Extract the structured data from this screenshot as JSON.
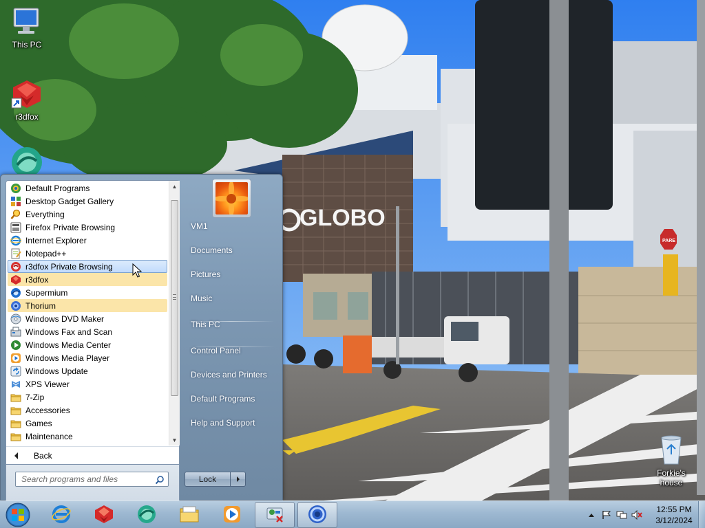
{
  "desktop": {
    "icons": [
      {
        "label": "This PC",
        "icon": "computer-icon"
      },
      {
        "label": "r3dfox",
        "icon": "r3dfox-icon"
      },
      {
        "label": "",
        "icon": "supermium-icon"
      },
      {
        "label": "Forkie's house",
        "icon": "recycle-bin-icon"
      }
    ],
    "wallpaper_sign": "GLOBO",
    "wallpaper_stop_sign": "PARE"
  },
  "start_menu": {
    "programs": [
      {
        "label": "Default Programs",
        "icon": "default-programs-icon",
        "state": ""
      },
      {
        "label": "Desktop Gadget Gallery",
        "icon": "gadget-gallery-icon",
        "state": ""
      },
      {
        "label": "Everything",
        "icon": "everything-search-icon",
        "state": ""
      },
      {
        "label": "Firefox Private Browsing",
        "icon": "firefox-private-icon",
        "state": ""
      },
      {
        "label": "Internet Explorer",
        "icon": "internet-explorer-icon",
        "state": ""
      },
      {
        "label": "Notepad++",
        "icon": "notepad-plus-plus-icon",
        "state": ""
      },
      {
        "label": "r3dfox Private Browsing",
        "icon": "r3dfox-private-icon",
        "state": "hover"
      },
      {
        "label": "r3dfox",
        "icon": "r3dfox-icon",
        "state": "recent"
      },
      {
        "label": "Supermium",
        "icon": "supermium-icon",
        "state": ""
      },
      {
        "label": "Thorium",
        "icon": "thorium-icon",
        "state": "recent"
      },
      {
        "label": "Windows DVD Maker",
        "icon": "dvd-maker-icon",
        "state": ""
      },
      {
        "label": "Windows Fax and Scan",
        "icon": "fax-scan-icon",
        "state": ""
      },
      {
        "label": "Windows Media Center",
        "icon": "media-center-icon",
        "state": ""
      },
      {
        "label": "Windows Media Player",
        "icon": "media-player-icon",
        "state": ""
      },
      {
        "label": "Windows Update",
        "icon": "windows-update-icon",
        "state": ""
      },
      {
        "label": "XPS Viewer",
        "icon": "xps-viewer-icon",
        "state": ""
      },
      {
        "label": "7-Zip",
        "icon": "folder-icon",
        "state": ""
      },
      {
        "label": "Accessories",
        "icon": "folder-icon",
        "state": ""
      },
      {
        "label": "Games",
        "icon": "folder-icon",
        "state": ""
      },
      {
        "label": "Maintenance",
        "icon": "folder-icon",
        "state": ""
      }
    ],
    "back_label": "Back",
    "search_placeholder": "Search programs and files",
    "right_items": [
      {
        "label": "VM1"
      },
      {
        "label": "Documents"
      },
      {
        "label": "Pictures"
      },
      {
        "label": "Music"
      },
      {
        "label": "This PC"
      },
      {
        "label": "Control Panel"
      },
      {
        "label": "Devices and Printers"
      },
      {
        "label": "Default Programs"
      },
      {
        "label": "Help and Support"
      }
    ],
    "lock_label": "Lock"
  },
  "taskbar": {
    "pinned": [
      {
        "icon": "internet-explorer-icon"
      },
      {
        "icon": "r3dfox-icon"
      },
      {
        "icon": "supermium-icon"
      },
      {
        "icon": "file-explorer-icon"
      },
      {
        "icon": "media-player-icon"
      },
      {
        "icon": "control-panel-icon"
      },
      {
        "icon": "thorium-icon"
      }
    ],
    "clock": {
      "time": "12:55 PM",
      "date": "3/12/2024"
    }
  }
}
